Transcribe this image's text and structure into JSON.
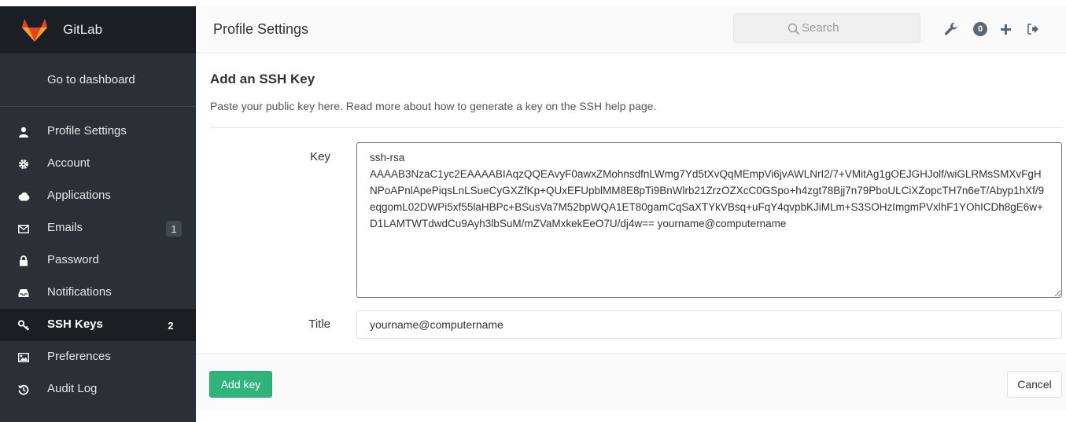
{
  "brand": {
    "name": "GitLab"
  },
  "sidebar": {
    "go_dashboard": "Go to dashboard",
    "items": [
      {
        "label": "Profile Settings",
        "icon": "user-icon",
        "count": ""
      },
      {
        "label": "Account",
        "icon": "gear-icon",
        "count": ""
      },
      {
        "label": "Applications",
        "icon": "cloud-icon",
        "count": ""
      },
      {
        "label": "Emails",
        "icon": "envelope-icon",
        "count": "1"
      },
      {
        "label": "Password",
        "icon": "lock-icon",
        "count": ""
      },
      {
        "label": "Notifications",
        "icon": "inbox-icon",
        "count": ""
      },
      {
        "label": "SSH Keys",
        "icon": "key-icon",
        "count": "2"
      },
      {
        "label": "Preferences",
        "icon": "image-icon",
        "count": ""
      },
      {
        "label": "Audit Log",
        "icon": "history-icon",
        "count": ""
      }
    ]
  },
  "header": {
    "title": "Profile Settings",
    "search_placeholder": "Search",
    "todo_count": "0"
  },
  "main": {
    "heading": "Add an SSH Key",
    "description": "Paste your public key here. Read more about how to generate a key on the SSH help page.",
    "key_label": "Key",
    "key_value": "ssh-rsa\nAAAAB3NzaC1yc2EAAAABIAqzQQEAvyF0awxZMohnsdfnLWmg7Yd5tXvQqMEmpVi6jvAWLNrI2/7+VMitAg1gOEJGHJolf/wiGLRMsSMXvFgHNPoAPnlApePiqsLnLSueCyGXZfKp+QUxEFUpblMM8E8pTi9BnWlrb21ZrzOZXcC0GSpo+h4zgt78Bjj7n79PboULCiXZopcTH7n6eT/Abyp1hXf/9eqgomL02DWPi5xf55laHBPc+BSusVa7M52bpWQA1ET80gamCqSaXTYkVBsq+uFqY4qvpbKJiMLm+S3SOHzImgmPVxlhF1YOhICDh8gE6w+D1LAMTWTdwdCu9Ayh3lbSuM/mZVaMxkekEeO7U/dj4w== yourname@computername",
    "title_label": "Title",
    "title_value": "yourname@computername",
    "add_button": "Add key",
    "cancel_button": "Cancel"
  },
  "colors": {
    "sidebar_bg": "#2a3036",
    "sidebar_active_bg": "#1b1f23",
    "primary_button": "#2eb47c",
    "logo_orange": "#e24329"
  }
}
